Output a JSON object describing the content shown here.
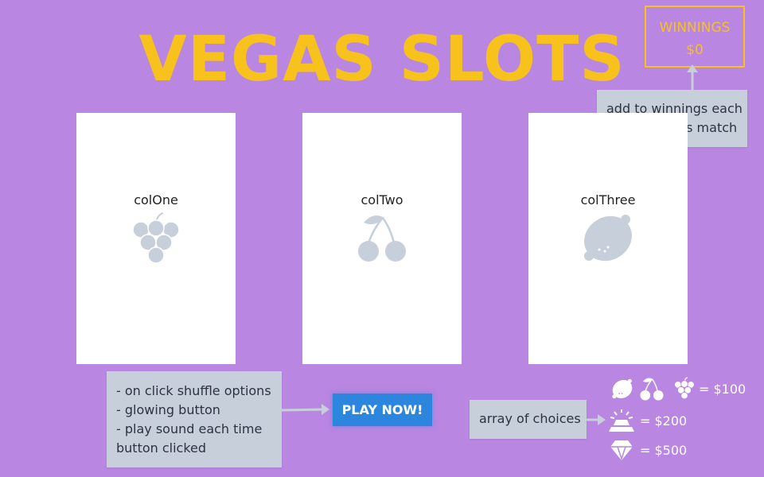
{
  "title": "VEGAS SLOTS",
  "winnings": {
    "label": "WINNINGS",
    "amount": "$0"
  },
  "notes": {
    "winnings": [
      "add to winnings each",
      "time columns match"
    ],
    "click": [
      "- on click shuffle options",
      "- glowing button",
      "- play sound each time",
      "button clicked"
    ],
    "array": "array of choices"
  },
  "columns": [
    {
      "label": "colOne",
      "icon": "grapes-icon"
    },
    {
      "label": "colTwo",
      "icon": "cherries-icon"
    },
    {
      "label": "colThree",
      "icon": "lemon-icon"
    }
  ],
  "play_button": {
    "label": "PLAY NOW!"
  },
  "legend": [
    {
      "icons": [
        "lemon-icon",
        "cherries-icon",
        "grapes-icon"
      ],
      "value": "= $100"
    },
    {
      "icons": [
        "bar-icon"
      ],
      "value": "= $200"
    },
    {
      "icons": [
        "diamond-icon"
      ],
      "value": "= $500"
    }
  ],
  "colors": {
    "background": "#b986e2",
    "accent": "#f7c21c",
    "button": "#2c86dd",
    "note": "#c7cfdb",
    "icon": "#c7cfdb"
  }
}
